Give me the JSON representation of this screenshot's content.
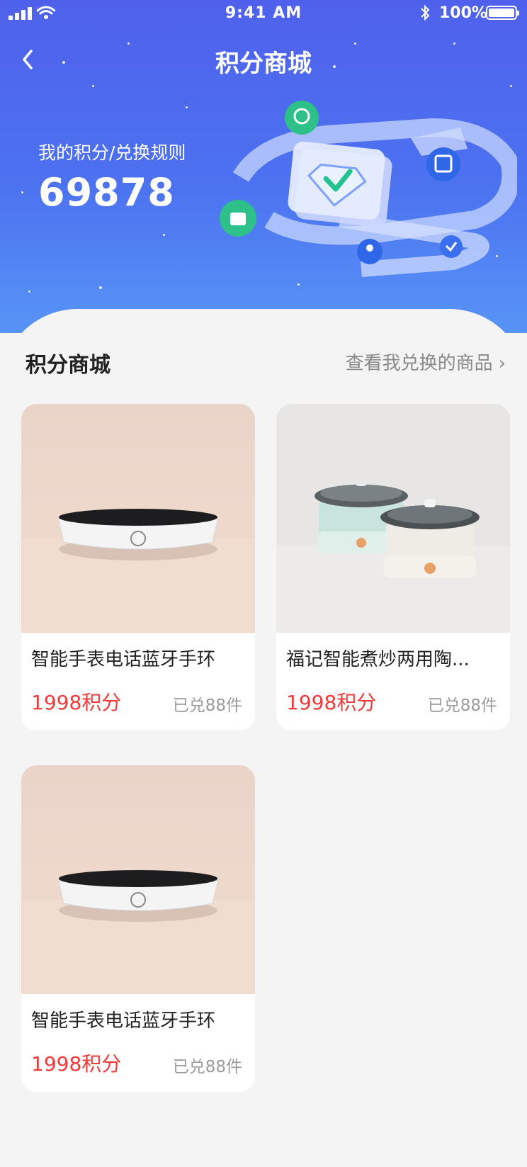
{
  "status_bar": {
    "time": "9:41 AM",
    "battery": "100%"
  },
  "nav": {
    "title": "积分商城"
  },
  "points": {
    "label": "我的积分/兑换规则",
    "value": "69878"
  },
  "section": {
    "title": "积分商城",
    "link": "查看我兑换的商品"
  },
  "products": [
    {
      "name": "智能手表电话蓝牙手环",
      "price": "1998积分",
      "sold": "已兑88件",
      "image": "induction-cooker"
    },
    {
      "name": "福记智能煮炒两用陶...",
      "price": "1998积分",
      "sold": "已兑88件",
      "image": "electric-hot-pots"
    },
    {
      "name": "智能手表电话蓝牙手环",
      "price": "1998积分",
      "sold": "已兑88件",
      "image": "induction-cooker"
    }
  ],
  "colors": {
    "header_top": "#4f61ec",
    "header_bottom": "#5794f6",
    "price": "#ef3a3a",
    "background": "#f4f4f4"
  }
}
